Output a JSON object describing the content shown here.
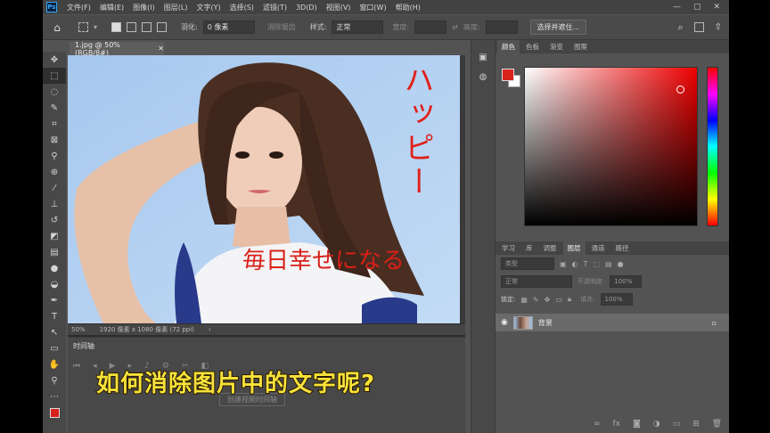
{
  "menubar": {
    "logo": "Ps",
    "items": [
      "文件(F)",
      "编辑(E)",
      "图像(I)",
      "图层(L)",
      "文字(Y)",
      "选择(S)",
      "滤镜(T)",
      "3D(D)",
      "视图(V)",
      "窗口(W)",
      "帮助(H)"
    ],
    "window_controls": [
      "—",
      "▢",
      "✕"
    ]
  },
  "options": {
    "feather_label": "羽化:",
    "feather_value": "0 像素",
    "antialias_label": "消除锯齿",
    "style_label": "样式:",
    "style_value": "正常",
    "width_label": "宽度:",
    "height_label": "高度:",
    "select_mask_button": "选择并遮住..."
  },
  "document": {
    "tab_title": "1.jpg @ 50%(RGB/8#)",
    "zoom": "50%",
    "status": "1920 像素 x 1080 像素 (72 ppi)",
    "overlay_text_vertical": "ハッピー",
    "overlay_text_horizontal": "毎日幸せになる"
  },
  "timeline": {
    "title": "时间轴",
    "create_button": "创建视频时间轴"
  },
  "caption": "如何消除图片中的文字呢?",
  "color_panel": {
    "tabs": [
      "颜色",
      "色板",
      "渐变",
      "图案"
    ],
    "fg_color": "#d7231c",
    "bg_color": "#ffffff"
  },
  "layers_panel": {
    "tabs": [
      "学习",
      "库",
      "调整",
      "图层",
      "通道",
      "路径"
    ],
    "filter_placeholder": "类型",
    "blend_mode": "正常",
    "opacity_label": "不透明度:",
    "opacity_value": "100%",
    "lock_label": "锁定:",
    "fill_label": "填充:",
    "fill_value": "100%",
    "layer_name": "背景"
  }
}
